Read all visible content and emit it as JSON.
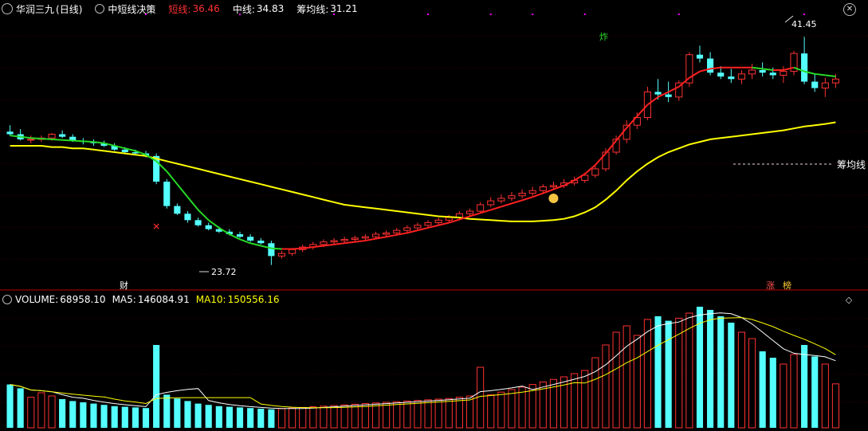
{
  "main_header": {
    "stock": "华润三九",
    "period": "(日线)",
    "indicator": "中短线决策",
    "short_label": "短线:",
    "short_value": "36.46",
    "mid_label": "中线:",
    "mid_value": "34.83",
    "cost_label": "筹均线:",
    "cost_value": "31.21"
  },
  "volume_header": {
    "label": "VOLUME:",
    "value": "68958.10",
    "ma5_label": "MA5:",
    "ma5_value": "146084.91",
    "ma10_label": "MA10:",
    "ma10_value": "150556.16"
  },
  "annotations": {
    "high_label": "41.45",
    "low_label": "23.72",
    "cost_line_label": "筹均线",
    "fin_marker": "财",
    "rise_marker": "涨",
    "board_marker": "榜",
    "blast_marker": "炸"
  },
  "colors": {
    "up": "#ff3232",
    "down": "#54ffff",
    "short_line_up": "#ff2020",
    "short_line_down": "#26d926",
    "mid_line": "#ffff00",
    "volume_ma5": "#ffffff",
    "volume_ma10": "#ffff00",
    "marker_pink": "#ff00ff"
  },
  "icons": {
    "menu": "circle-down-icon",
    "close": "close-icon",
    "collapse": "diamond-icon",
    "money_bag": "money-bag-icon"
  },
  "chart_data": [
    {
      "type": "candlestick",
      "ylim": [
        22,
        43
      ],
      "candles": [
        [
          34.1,
          34.6,
          33.8,
          33.9
        ],
        [
          33.9,
          34.3,
          33.4,
          33.5
        ],
        [
          33.5,
          33.8,
          33.2,
          33.5
        ],
        [
          33.5,
          33.8,
          33.3,
          33.6
        ],
        [
          33.6,
          34.0,
          33.4,
          33.9
        ],
        [
          33.9,
          34.2,
          33.6,
          33.7
        ],
        [
          33.7,
          33.9,
          33.3,
          33.4
        ],
        [
          33.4,
          33.6,
          33.1,
          33.3
        ],
        [
          33.3,
          33.5,
          33.0,
          33.2
        ],
        [
          33.2,
          33.4,
          32.9,
          33.0
        ],
        [
          33.0,
          33.2,
          32.6,
          32.7
        ],
        [
          32.7,
          32.9,
          32.4,
          32.5
        ],
        [
          32.5,
          32.7,
          32.3,
          32.4
        ],
        [
          32.4,
          32.6,
          32.1,
          32.2
        ],
        [
          32.2,
          32.4,
          30.0,
          30.2
        ],
        [
          30.2,
          30.4,
          28.1,
          28.3
        ],
        [
          28.3,
          28.5,
          27.6,
          27.7
        ],
        [
          27.7,
          27.9,
          27.0,
          27.2
        ],
        [
          27.2,
          27.4,
          26.7,
          26.8
        ],
        [
          26.8,
          27.0,
          26.4,
          26.5
        ],
        [
          26.5,
          26.7,
          26.2,
          26.3
        ],
        [
          26.3,
          26.5,
          26.0,
          26.1
        ],
        [
          26.1,
          26.3,
          25.8,
          25.9
        ],
        [
          25.9,
          26.1,
          25.5,
          25.6
        ],
        [
          25.6,
          25.8,
          25.3,
          25.4
        ],
        [
          25.4,
          25.6,
          23.7,
          24.4
        ],
        [
          24.4,
          24.8,
          24.2,
          24.6
        ],
        [
          24.6,
          25.0,
          24.4,
          24.9
        ],
        [
          24.9,
          25.3,
          24.7,
          25.1
        ],
        [
          25.1,
          25.5,
          24.9,
          25.3
        ],
        [
          25.3,
          25.7,
          25.1,
          25.5
        ],
        [
          25.5,
          25.8,
          25.3,
          25.6
        ],
        [
          25.6,
          25.9,
          25.4,
          25.7
        ],
        [
          25.7,
          26.0,
          25.5,
          25.8
        ],
        [
          25.8,
          26.1,
          25.6,
          25.9
        ],
        [
          25.9,
          26.3,
          25.7,
          26.1
        ],
        [
          26.1,
          26.4,
          25.9,
          26.2
        ],
        [
          26.2,
          26.6,
          26.0,
          26.4
        ],
        [
          26.4,
          26.8,
          26.2,
          26.6
        ],
        [
          26.6,
          27.0,
          26.4,
          26.8
        ],
        [
          26.8,
          27.2,
          26.6,
          27.0
        ],
        [
          27.0,
          27.4,
          26.8,
          27.2
        ],
        [
          27.2,
          27.6,
          27.0,
          27.4
        ],
        [
          27.4,
          27.9,
          27.2,
          27.7
        ],
        [
          27.7,
          28.1,
          27.5,
          27.9
        ],
        [
          27.9,
          28.6,
          27.7,
          28.4
        ],
        [
          28.4,
          29.0,
          28.2,
          28.7
        ],
        [
          28.7,
          29.2,
          28.5,
          28.9
        ],
        [
          28.9,
          29.4,
          28.7,
          29.1
        ],
        [
          29.1,
          29.6,
          28.9,
          29.3
        ],
        [
          29.3,
          29.8,
          29.1,
          29.5
        ],
        [
          29.5,
          30.0,
          29.3,
          29.8
        ],
        [
          29.8,
          30.2,
          29.6,
          29.9
        ],
        [
          29.9,
          30.4,
          29.7,
          30.1
        ],
        [
          30.1,
          30.6,
          29.9,
          30.3
        ],
        [
          30.3,
          30.9,
          30.1,
          30.7
        ],
        [
          30.7,
          31.5,
          30.5,
          31.2
        ],
        [
          31.2,
          32.8,
          31.0,
          32.5
        ],
        [
          32.5,
          33.8,
          32.3,
          33.5
        ],
        [
          33.5,
          35.0,
          33.2,
          34.6
        ],
        [
          34.6,
          35.6,
          34.3,
          35.2
        ],
        [
          35.2,
          37.6,
          35.0,
          37.2
        ],
        [
          37.2,
          38.2,
          36.6,
          37.0
        ],
        [
          37.0,
          38.0,
          36.4,
          36.8
        ],
        [
          36.8,
          38.1,
          36.5,
          37.9
        ],
        [
          37.9,
          40.3,
          37.6,
          40.1
        ],
        [
          40.1,
          40.8,
          39.5,
          39.8
        ],
        [
          39.8,
          40.3,
          38.5,
          38.7
        ],
        [
          38.7,
          39.2,
          38.2,
          38.4
        ],
        [
          38.4,
          39.0,
          37.9,
          38.2
        ],
        [
          38.2,
          38.9,
          37.8,
          38.6
        ],
        [
          38.6,
          39.4,
          38.2,
          38.9
        ],
        [
          38.9,
          39.5,
          38.4,
          38.7
        ],
        [
          38.7,
          39.1,
          38.2,
          38.5
        ],
        [
          38.5,
          39.2,
          37.9,
          38.8
        ],
        [
          38.8,
          40.4,
          38.5,
          40.2
        ],
        [
          40.2,
          41.5,
          37.8,
          38.0
        ],
        [
          38.0,
          38.6,
          37.2,
          37.5
        ],
        [
          37.5,
          38.3,
          36.8,
          37.9
        ],
        [
          37.9,
          38.6,
          37.5,
          38.2
        ]
      ],
      "short_line": [
        33.8,
        33.7,
        33.6,
        33.55,
        33.5,
        33.45,
        33.4,
        33.35,
        33.3,
        33.2,
        33.0,
        32.8,
        32.6,
        32.3,
        31.8,
        31.0,
        30.0,
        29.0,
        28.0,
        27.2,
        26.6,
        26.1,
        25.7,
        25.4,
        25.2,
        25.0,
        24.95,
        24.95,
        25.0,
        25.1,
        25.2,
        25.3,
        25.4,
        25.5,
        25.6,
        25.75,
        25.9,
        26.05,
        26.2,
        26.4,
        26.6,
        26.8,
        27.0,
        27.25,
        27.5,
        27.75,
        28.0,
        28.25,
        28.5,
        28.75,
        29.0,
        29.3,
        29.6,
        29.9,
        30.3,
        30.8,
        31.5,
        32.4,
        33.4,
        34.4,
        35.3,
        36.2,
        36.8,
        37.2,
        37.6,
        38.3,
        38.8,
        39.0,
        39.1,
        39.1,
        39.1,
        39.1,
        39.0,
        38.9,
        38.9,
        39.1,
        38.8,
        38.6,
        38.5,
        38.4
      ],
      "mid_line": [
        33.0,
        33.0,
        33.0,
        33.0,
        32.9,
        32.9,
        32.8,
        32.8,
        32.7,
        32.6,
        32.5,
        32.4,
        32.3,
        32.2,
        32.0,
        31.8,
        31.6,
        31.4,
        31.2,
        31.0,
        30.8,
        30.6,
        30.4,
        30.2,
        30.0,
        29.8,
        29.6,
        29.4,
        29.2,
        29.0,
        28.8,
        28.6,
        28.4,
        28.3,
        28.2,
        28.1,
        28.0,
        27.9,
        27.8,
        27.7,
        27.6,
        27.5,
        27.45,
        27.4,
        27.3,
        27.25,
        27.2,
        27.15,
        27.1,
        27.1,
        27.1,
        27.15,
        27.2,
        27.3,
        27.5,
        27.8,
        28.2,
        28.8,
        29.5,
        30.3,
        31.0,
        31.6,
        32.1,
        32.5,
        32.8,
        33.1,
        33.3,
        33.5,
        33.6,
        33.7,
        33.8,
        33.9,
        34.0,
        34.1,
        34.2,
        34.35,
        34.5,
        34.6,
        34.7,
        34.83
      ],
      "volume": [
        68000,
        62000,
        48000,
        55000,
        50000,
        45000,
        42000,
        40000,
        38000,
        36000,
        34000,
        33000,
        32000,
        31000,
        130000,
        52000,
        46000,
        42000,
        38000,
        36000,
        34000,
        33000,
        32000,
        31000,
        30000,
        29000,
        30000,
        31000,
        32000,
        33000,
        34000,
        35000,
        36000,
        37000,
        38000,
        39000,
        40000,
        41000,
        42000,
        43000,
        44000,
        45000,
        46000,
        48000,
        50000,
        95000,
        52000,
        56000,
        60000,
        64000,
        68000,
        72000,
        76000,
        80000,
        85000,
        90000,
        110000,
        130000,
        150000,
        160000,
        145000,
        170000,
        175000,
        168000,
        172000,
        180000,
        190000,
        185000,
        175000,
        165000,
        150000,
        140000,
        120000,
        110000,
        100000,
        115000,
        130000,
        112000,
        100000,
        68958.1
      ]
    }
  ]
}
